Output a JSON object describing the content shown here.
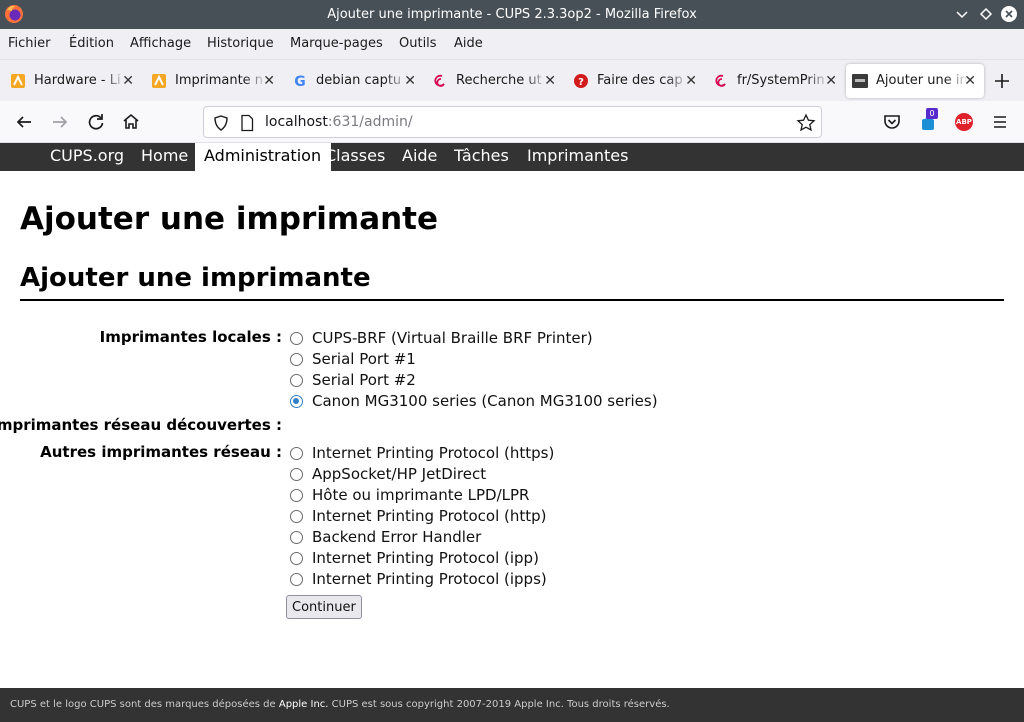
{
  "window": {
    "title": "Ajouter une imprimante - CUPS 2.3.3op2 - Mozilla Firefox"
  },
  "menu": [
    "Fichier",
    "Édition",
    "Affichage",
    "Historique",
    "Marque-pages",
    "Outils",
    "Aide"
  ],
  "tabs": [
    {
      "label": "Hardware - Li",
      "icon": "ubuntu-forum-icon"
    },
    {
      "label": "Imprimante n",
      "icon": "ubuntu-forum-icon"
    },
    {
      "label": "debian captu",
      "icon": "google-icon"
    },
    {
      "label": "Recherche ut",
      "icon": "debian-icon"
    },
    {
      "label": "Faire des cap",
      "icon": "quora-icon"
    },
    {
      "label": "fr/SystemPrin",
      "icon": "debian-icon"
    },
    {
      "label": "Ajouter une in",
      "icon": "cups-icon",
      "active": true
    }
  ],
  "urlbar": {
    "host": "localhost",
    "path": ":631/admin/"
  },
  "extensions": {
    "badge_count": "0",
    "abp_label": "ABP"
  },
  "cups_nav": [
    "CUPS.org",
    "Home",
    "Administration",
    "Classes",
    "Aide",
    "Tâches",
    "Imprimantes"
  ],
  "cups_nav_active": "Administration",
  "page": {
    "title": "Ajouter une imprimante",
    "subtitle": "Ajouter une imprimante",
    "groups": {
      "local": {
        "label": "Imprimantes locales :",
        "options": [
          "CUPS-BRF (Virtual Braille BRF Printer)",
          "Serial Port #1",
          "Serial Port #2",
          "Canon MG3100 series (Canon MG3100 series)"
        ],
        "selected": "Canon MG3100 series (Canon MG3100 series)"
      },
      "discovered": {
        "label": "Imprimantes réseau découvertes :"
      },
      "other": {
        "label": "Autres imprimantes réseau :",
        "options": [
          "Internet Printing Protocol (https)",
          "AppSocket/HP JetDirect",
          "Hôte ou imprimante LPD/LPR",
          "Internet Printing Protocol (http)",
          "Backend Error Handler",
          "Internet Printing Protocol (ipp)",
          "Internet Printing Protocol (ipps)"
        ]
      }
    },
    "continue_label": "Continuer"
  },
  "footer": {
    "text_before": "CUPS et le logo CUPS sont des marques déposées de ",
    "company": "Apple Inc.",
    "text_after": " CUPS est sous copyright 2007-2019 Apple Inc. Tous droits réservés."
  },
  "colors": {
    "cups_bar": "#333333",
    "radio_checked": "#2f80c8",
    "titlebar": "#475057"
  }
}
